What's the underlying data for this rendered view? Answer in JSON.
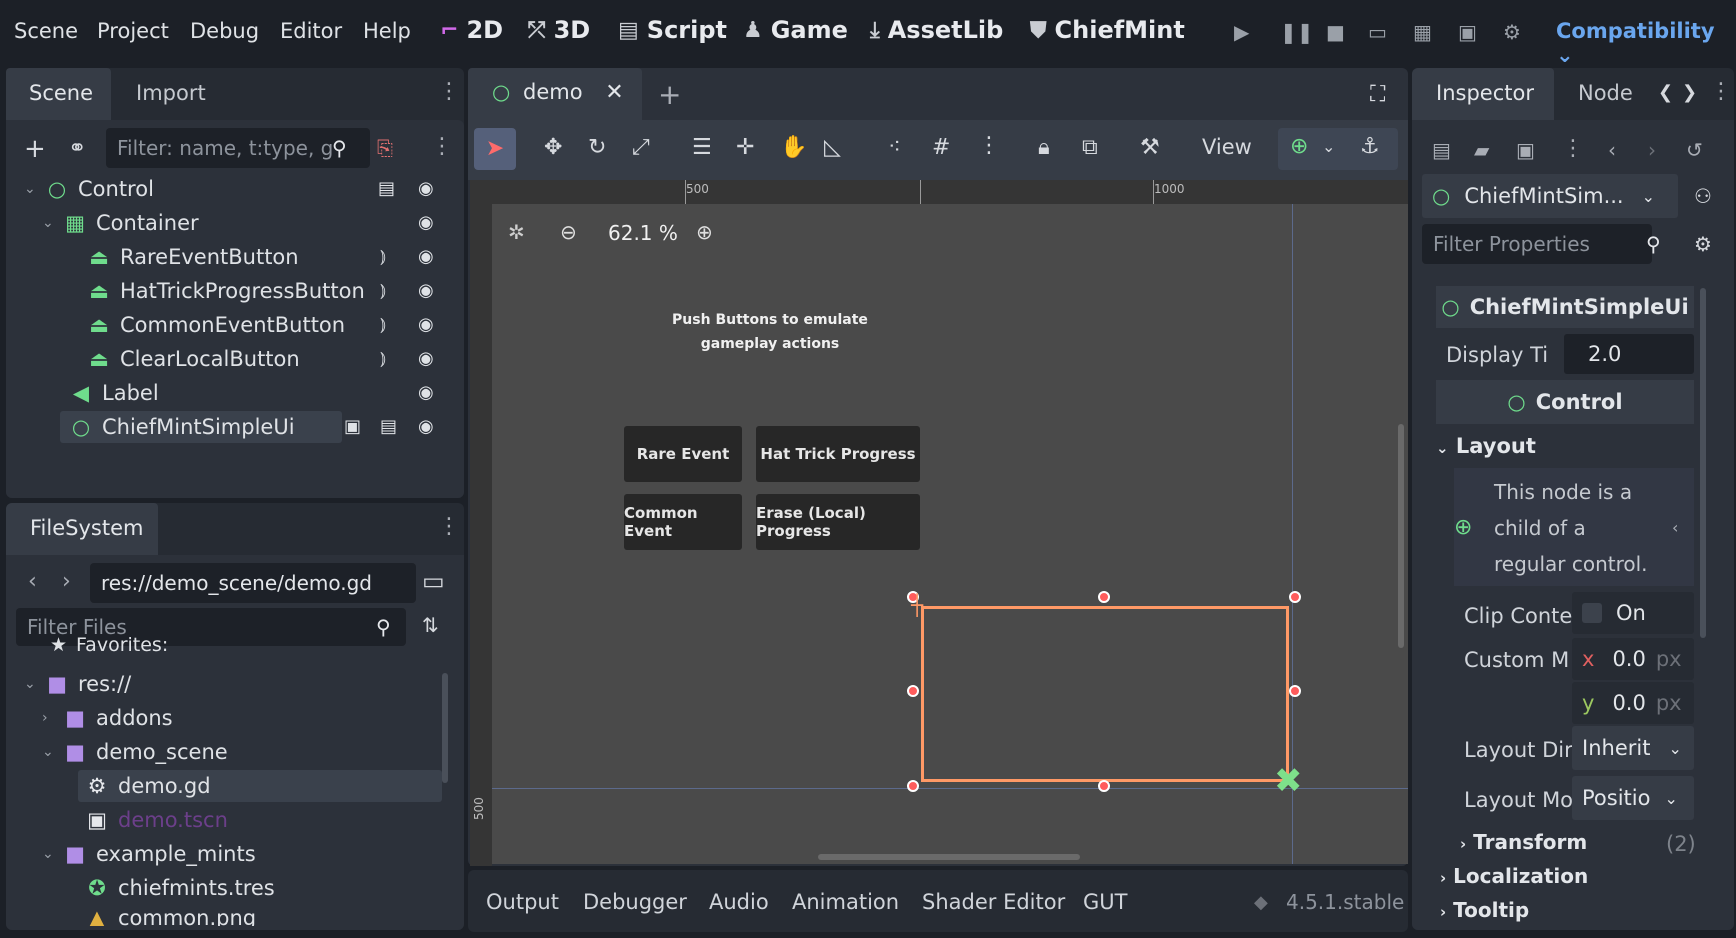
{
  "menu": [
    "Scene",
    "Project",
    "Debug",
    "Editor",
    "Help"
  ],
  "workspaces": {
    "w2d": "2D",
    "w3d": "3D",
    "script": "Script",
    "game": "Game",
    "assetlib": "AssetLib",
    "chiefmint": "ChiefMint"
  },
  "renderer": "Compatibility",
  "scene_dock": {
    "tabs": {
      "scene": "Scene",
      "import": "Import"
    },
    "filter_placeholder": "Filter: name, t:type, g",
    "tree": {
      "control": "Control",
      "container": "Container",
      "rare": "RareEventButton",
      "hattrick": "HatTrickProgressButton",
      "common": "CommonEventButton",
      "clear": "ClearLocalButton",
      "label": "Label",
      "chiefmint": "ChiefMintSimpleUi"
    }
  },
  "filesystem": {
    "tab": "FileSystem",
    "path": "res://demo_scene/demo.gd",
    "filter_placeholder": "Filter Files",
    "items": {
      "favorites": "Favorites:",
      "res": "res://",
      "addons": "addons",
      "demo_scene": "demo_scene",
      "demo_gd": "demo.gd",
      "demo_tscn": "demo.tscn",
      "example_mints": "example_mints",
      "chiefmints": "chiefmints.tres",
      "common_png": "common.png"
    }
  },
  "editor": {
    "tab": "demo",
    "view_label": "View",
    "zoom": "62.1 %",
    "ruler_500": "500",
    "ruler_1000": "1000",
    "ruler_v500": "500",
    "game_label_line1": "Push Buttons to emulate",
    "game_label_line2": "gameplay actions",
    "buttons": {
      "rare": "Rare Event",
      "hattrick": "Hat Trick Progress",
      "common": "Common Event",
      "erase": "Erase (Local) Progress"
    }
  },
  "inspector": {
    "tabs": {
      "inspector": "Inspector",
      "node": "Node"
    },
    "node_select": "ChiefMintSim...",
    "filter_placeholder": "Filter Properties",
    "class_header": "ChiefMintSimpleUi",
    "display_time_label": "Display Ti",
    "display_time_value": "2.0",
    "control_header": "Control",
    "layout_section": "Layout",
    "warning_l1": "This node is a",
    "warning_l2": "child of a",
    "warning_l3": "regular control.",
    "clip_label": "Clip Conte",
    "clip_value": "On",
    "custom_label": "Custom M",
    "x_label": "x",
    "x_value": "0.0",
    "y_label": "y",
    "y_value": "0.0",
    "unit": "px",
    "layout_dir_label": "Layout Dir",
    "layout_dir_value": "Inherit",
    "layout_mode_label": "Layout Mo",
    "layout_mode_value": "Positio",
    "transform": "Transform",
    "transform_count": "(2)",
    "localization": "Localization",
    "tooltip": "Tooltip"
  },
  "bottom": {
    "output": "Output",
    "debugger": "Debugger",
    "audio": "Audio",
    "animation": "Animation",
    "shader": "Shader Editor",
    "gut": "GUT",
    "version": "4.5.1.stable"
  }
}
